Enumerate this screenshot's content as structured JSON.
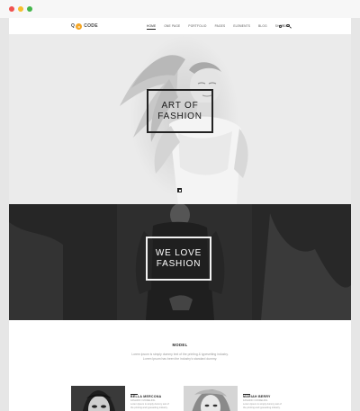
{
  "browser": {
    "dots": [
      {
        "name": "close-dot",
        "color": "#f0524f"
      },
      {
        "name": "minimize-dot",
        "color": "#f6be2d"
      },
      {
        "name": "maximize-dot",
        "color": "#43b64b"
      }
    ]
  },
  "header": {
    "logo": {
      "letter": "Q",
      "circle_char": "o",
      "circle_color": "#f5a623",
      "text": "CODE"
    },
    "nav": [
      {
        "label": "Home",
        "active": true
      },
      {
        "label": "One page",
        "active": false
      },
      {
        "label": "Portfolio",
        "active": false
      },
      {
        "label": "Pages",
        "active": false
      },
      {
        "label": "Elements",
        "active": false
      },
      {
        "label": "Blog",
        "active": false
      },
      {
        "label": "Shop",
        "active": false
      }
    ],
    "cart_label": "$0.00",
    "search_icon": "search-icon"
  },
  "hero": {
    "line1": "ART OF",
    "line2": "FASHION"
  },
  "dark_section": {
    "line1": "WE LOVE",
    "line2": "FASHION"
  },
  "model": {
    "title": "MODEL",
    "description": "Lorem ipsum is simply dummy text of the printing & typesetting industry. Lorem Ipsum has been the industry's standard dummy.",
    "cards": [
      {
        "name": "BELLA MERCONA",
        "role": "FASHION / MODELING",
        "text": "Lorem Ipsum is simply dummy text of the printing and typesetting industry."
      },
      {
        "name": "MARIAH BERRY",
        "role": "FASHION / MODELING",
        "text": "Lorem Ipsum is simply dummy text of the printing and typesetting industry."
      }
    ]
  }
}
